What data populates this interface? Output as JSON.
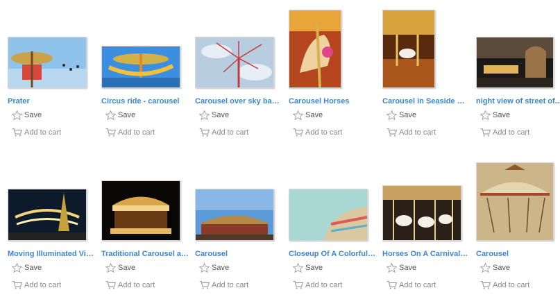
{
  "items": [
    {
      "title": "Prater",
      "save_label": "Save",
      "cart_label": "Add to cart"
    },
    {
      "title": "Circus ride - carousel",
      "save_label": "Save",
      "cart_label": "Add to cart"
    },
    {
      "title": "Carousel over sky background",
      "save_label": "Save",
      "cart_label": "Add to cart"
    },
    {
      "title": "Carousel Horses",
      "save_label": "Save",
      "cart_label": "Add to cart"
    },
    {
      "title": "Carousel in Seaside Heights",
      "save_label": "Save",
      "cart_label": "Add to cart"
    },
    {
      "title": "night view of street of...",
      "save_label": "Save",
      "cart_label": "Add to cart"
    },
    {
      "title": "Moving Illuminated Vintage Carousel",
      "save_label": "Save",
      "cart_label": "Add to cart"
    },
    {
      "title": "Traditional Carousel at night",
      "save_label": "Save",
      "cart_label": "Add to cart"
    },
    {
      "title": "Carousel",
      "save_label": "Save",
      "cart_label": "Add to cart"
    },
    {
      "title": "Closeup Of A Colorful Carousel",
      "save_label": "Save",
      "cart_label": "Add to cart"
    },
    {
      "title": "Horses On A Carnival Carousel",
      "save_label": "Save",
      "cart_label": "Add to cart"
    },
    {
      "title": "Carousel",
      "save_label": "Save",
      "cart_label": "Add to cart"
    }
  ],
  "colors": {
    "title_link": "#3b86d1",
    "action_text": "#555555",
    "icon": "#999999"
  },
  "icons": {
    "save": "star-outline-icon",
    "cart": "shopping-cart-icon"
  }
}
